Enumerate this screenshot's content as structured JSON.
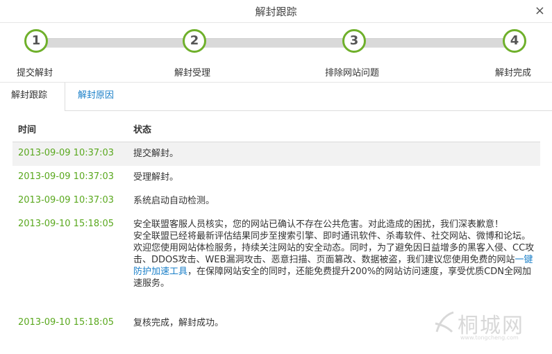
{
  "dialog": {
    "title": "解封跟踪",
    "close_glyph": "×"
  },
  "steps": [
    {
      "number": "1",
      "label": "提交解封"
    },
    {
      "number": "2",
      "label": "解封受理"
    },
    {
      "number": "3",
      "label": "排除网站问题"
    },
    {
      "number": "4",
      "label": "解封完成"
    }
  ],
  "tabs": [
    {
      "label": "解封跟踪",
      "active": true
    },
    {
      "label": "解封原因",
      "active": false
    }
  ],
  "table": {
    "headers": {
      "time": "时间",
      "status": "状态"
    },
    "rows": [
      {
        "time": "2013-09-09 10:37:03",
        "status": "提交解封。"
      },
      {
        "time": "2013-09-09 10:37:03",
        "status": "受理解封。"
      },
      {
        "time": "2013-09-09 10:37:03",
        "status": "系统启动自动检测。"
      },
      {
        "time": "2013-09-10 15:18:05",
        "status_p1": "安全联盟客服人员核实，您的网站已确认不存在公共危害。对此造成的困扰，我们深表歉意！",
        "status_p2": "安全联盟已经将最新评估结果同步至搜索引擎、即时通讯软件、杀毒软件、社交网站、微博和论坛。",
        "status_p3a": "欢迎您使用网站体检服务，持续关注网站的安全动态。同时，为了避免因日益增多的黑客入侵、CC攻击、DDOS攻击、WEB漏洞攻击、恶意扫描、页面篡改、数据被盗，我们建议您使用免费的网站",
        "status_link": "一键防护加速工具",
        "status_p3b": "，在保障网站安全的同时，还能免费提升200%的网站访问速度，享受优质CDN全网加速服务。"
      },
      {
        "time": "2013-09-10 15:18:05",
        "status": "复核完成，解封成功。"
      }
    ]
  },
  "watermark": {
    "text": "桐城网",
    "sub": "www.tongcheng.com"
  },
  "colors": {
    "accent_green": "#6fb02b",
    "time_green": "#5aa81e",
    "link_blue": "#1a7fc8"
  }
}
